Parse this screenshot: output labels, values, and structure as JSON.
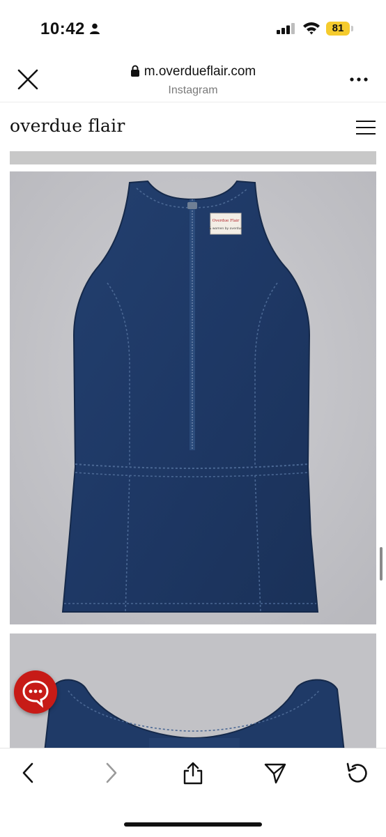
{
  "status_bar": {
    "time": "10:42",
    "battery": "81"
  },
  "browser": {
    "url": "m.overdueflair.com",
    "source": "Instagram"
  },
  "site": {
    "brand": "overdue flair"
  },
  "product": {
    "label_line1": "Overdue Flair",
    "label_line2": "& women by overdue"
  },
  "colors": {
    "denim": "#1f3966",
    "background": "#c4c4c8",
    "chat_button": "#c71b17",
    "battery": "#f5cb2d"
  },
  "icons": [
    "person-icon",
    "signal-icon",
    "wifi-icon",
    "lock-icon",
    "close-icon",
    "more-icon",
    "menu-icon",
    "chat-icon",
    "back-icon",
    "forward-icon",
    "share-icon",
    "send-icon",
    "reload-icon"
  ]
}
